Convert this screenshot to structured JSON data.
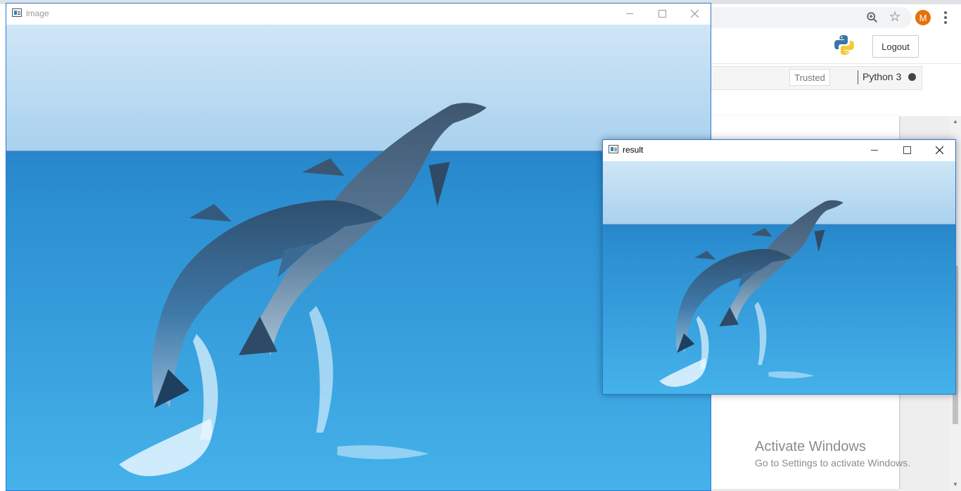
{
  "browser": {
    "avatar_letter": "M",
    "zoom_icon": "magnifier-zoom-icon",
    "star_icon": "star-bookmark-icon"
  },
  "jupyter": {
    "logout_label": "Logout",
    "trusted_label": "Trusted",
    "kernel_name": "Python 3",
    "kernel_status_color": "#444444"
  },
  "windows": {
    "image": {
      "title": "image"
    },
    "result": {
      "title": "result"
    }
  },
  "activation": {
    "title": "Activate Windows",
    "subtitle": "Go to Settings to activate Windows."
  },
  "colors": {
    "window_border": "#2b79d8",
    "sky": "#cfe6f6",
    "sea": "#2c8fd2",
    "avatar": "#e8710a"
  }
}
